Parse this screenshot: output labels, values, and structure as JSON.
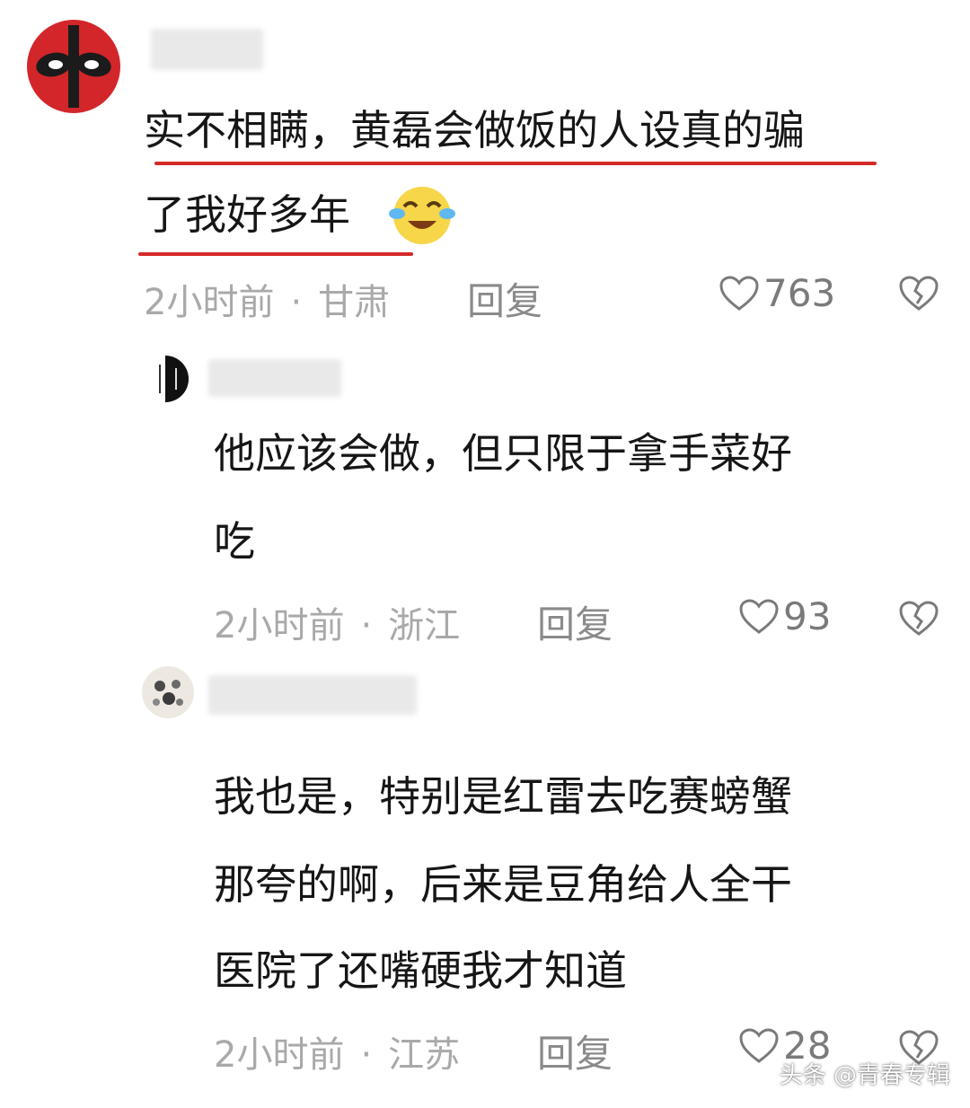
{
  "comments": [
    {
      "avatar_icon": "deadpool-mask-avatar",
      "text_lines": [
        "实不相瞒，黄磊会做饭的人设真的骗",
        "了我好多年"
      ],
      "emoji_icon": "tears-of-joy-emoji",
      "time": "2小时前",
      "location": "甘肃",
      "reply_label": "回复",
      "likes": "763"
    },
    {
      "avatar_icon": "calligraphy-avatar",
      "text_lines": [
        "他应该会做，但只限于拿手菜好",
        "吃"
      ],
      "time": "2小时前",
      "location": "浙江",
      "reply_label": "回复",
      "likes": "93"
    },
    {
      "avatar_icon": "pattern-avatar",
      "text_lines": [
        "我也是，特别是红雷去吃赛螃蟹",
        "那夸的啊，后来是豆角给人全干",
        "医院了还嘴硬我才知道"
      ],
      "time": "2小时前",
      "location": "江苏",
      "reply_label": "回复",
      "likes": "28"
    }
  ],
  "colors": {
    "underline": "#d42a2a",
    "meta": "#a9a9a9"
  },
  "watermark": "头条 @青春专辑"
}
